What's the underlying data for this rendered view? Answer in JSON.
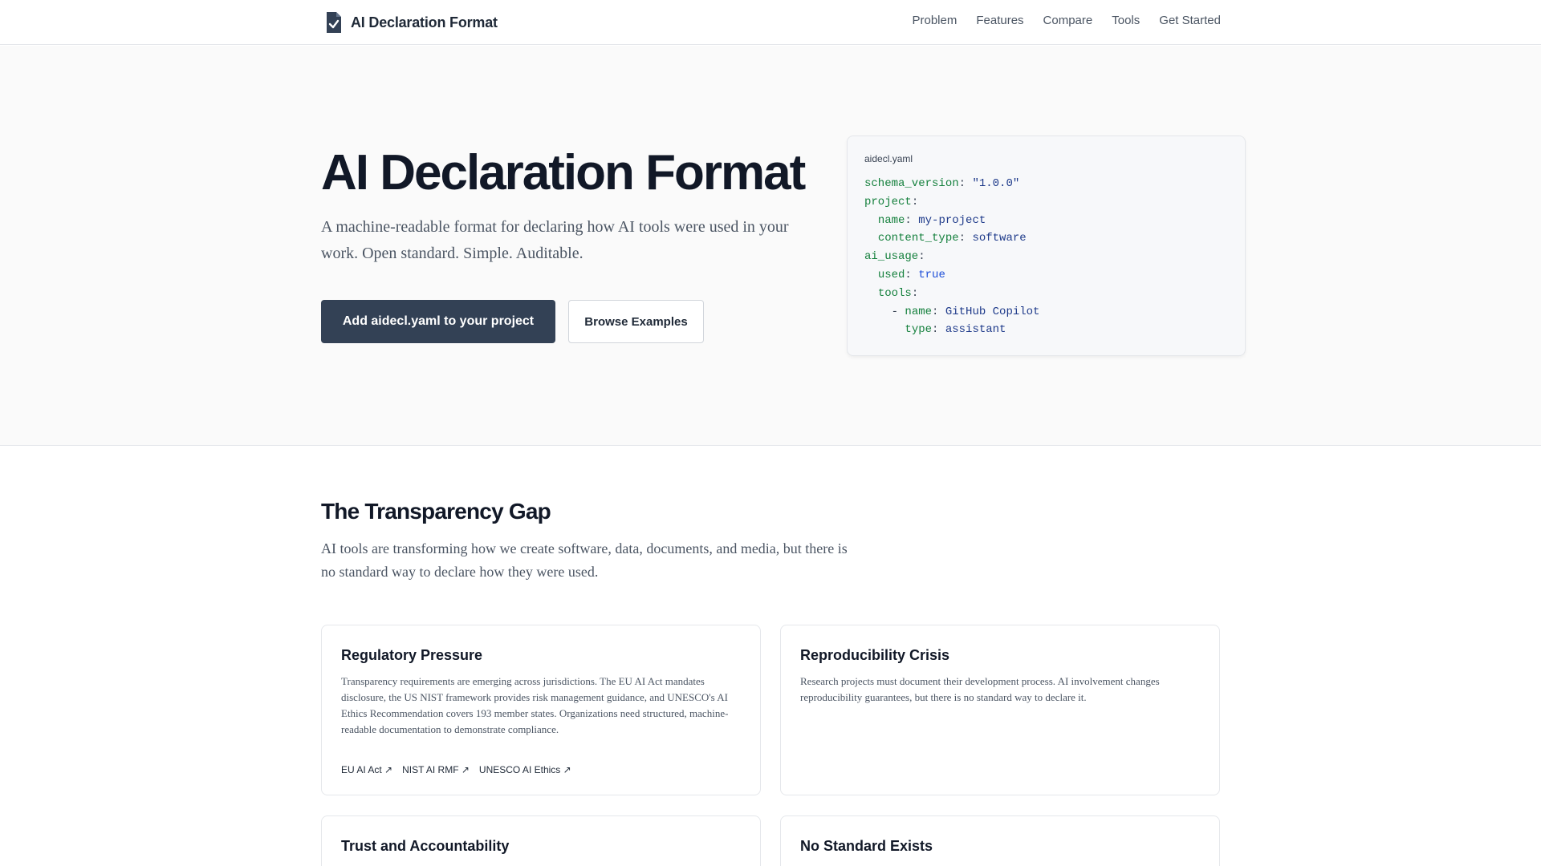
{
  "header": {
    "brand": "AI Declaration Format",
    "logo_icon": "document-check-icon",
    "nav": [
      "Problem",
      "Features",
      "Compare",
      "Tools",
      "Get Started"
    ]
  },
  "hero": {
    "title": "AI Declaration Format",
    "subtitle": "A machine-readable format for declaring how AI tools were used in your work. Open standard. Simple. Auditable.",
    "primary_button": "Add aidecl.yaml to your project",
    "secondary_button": "Browse Examples",
    "code_card": {
      "filename": "aidecl.yaml",
      "lines": [
        {
          "indent": "",
          "key": "schema_version",
          "value": "\"1.0.0\"",
          "value_type": "string"
        },
        {
          "indent": "",
          "key": "project",
          "value": "",
          "value_type": ""
        },
        {
          "indent": "  ",
          "key": "name",
          "value": "my-project",
          "value_type": "string"
        },
        {
          "indent": "  ",
          "key": "content_type",
          "value": "software",
          "value_type": "string"
        },
        {
          "indent": "",
          "key": "ai_usage",
          "value": "",
          "value_type": ""
        },
        {
          "indent": "  ",
          "key": "used",
          "value": "true",
          "value_type": "bool"
        },
        {
          "indent": "  ",
          "key": "tools",
          "value": "",
          "value_type": ""
        },
        {
          "indent": "    - ",
          "key": "name",
          "value": "GitHub Copilot",
          "value_type": "string"
        },
        {
          "indent": "      ",
          "key": "type",
          "value": "assistant",
          "value_type": "string"
        }
      ]
    }
  },
  "problem": {
    "title": "The Transparency Gap",
    "subtitle": "AI tools are transforming how we create software, data, documents, and media, but there is no standard way to declare how they were used.",
    "cards": [
      {
        "title": "Regulatory Pressure",
        "text": "Transparency requirements are emerging across jurisdictions. The EU AI Act mandates disclosure, the US NIST framework provides risk management guidance, and UNESCO's AI Ethics Recommendation covers 193 member states. Organizations need structured, machine-readable documentation to demonstrate compliance.",
        "links": [
          "EU AI Act ↗",
          "NIST AI RMF ↗",
          "UNESCO AI Ethics ↗"
        ]
      },
      {
        "title": "Reproducibility Crisis",
        "text": "Research projects must document their development process. AI involvement changes reproducibility guarantees, but there is no standard way to declare it."
      },
      {
        "title": "Trust and Accountability",
        "text": ""
      },
      {
        "title": "No Standard Exists",
        "text": ""
      }
    ]
  },
  "colors": {
    "primary_button": "#334155",
    "yaml_key": "#15803d",
    "yaml_string": "#1e3a8a",
    "yaml_bool": "#1d4ed8"
  }
}
